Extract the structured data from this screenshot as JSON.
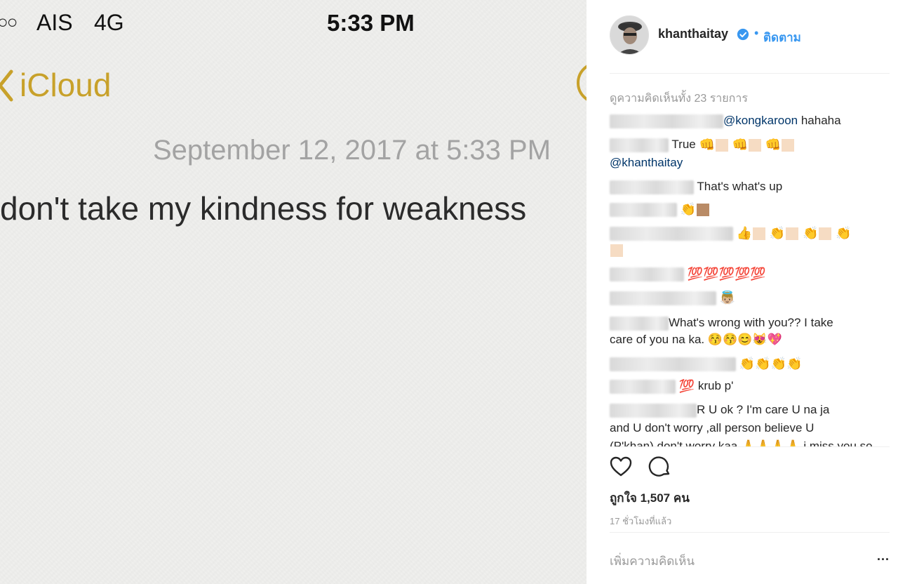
{
  "status_bar": {
    "signal": "○○",
    "carrier": "AIS",
    "network": "4G",
    "time": "5:33 PM"
  },
  "notes": {
    "back_label": "iCloud",
    "date": "September 12, 2017 at 5:33 PM",
    "text": "don't take my kindness for weakness"
  },
  "post": {
    "username": "khanthaitay",
    "follow_label": "ติดตาม",
    "dot": "•",
    "view_all_comments": "ดูความคิดเห็นทั้ง 23 รายการ",
    "comments": [
      {
        "mention": "@kongkaroon",
        "text": " hahaha"
      },
      {
        "text": "True",
        "mention2": "@khanthaitay"
      },
      {
        "text": "That's what's up"
      },
      {
        "emoji": "👏"
      },
      {
        "emoji": "👍"
      },
      {
        "emoji": "💯💯💯💯💯"
      },
      {
        "emoji": "👼🏼"
      },
      {
        "text": "What's wrong with you?? I take",
        "text2": "care of you na ka. 😚😚😊😻💖"
      },
      {
        "emoji": "👏👏👏👏"
      },
      {
        "emoji": "💯",
        "text": " krub p'"
      },
      {
        "text": "R U ok ? I'm care U na ja",
        "text2": "and U don't worry ,all person believe U",
        "text3": "(P'khan) don't worry kaa 🙏🙏🙏🙏 i miss you so"
      }
    ],
    "likes": "ถูกใจ 1,507 คน",
    "time_ago": "17 ชั่วโมงที่แล้ว",
    "add_comment_placeholder": "เพิ่มความคิดเห็น",
    "more_label": "..."
  }
}
